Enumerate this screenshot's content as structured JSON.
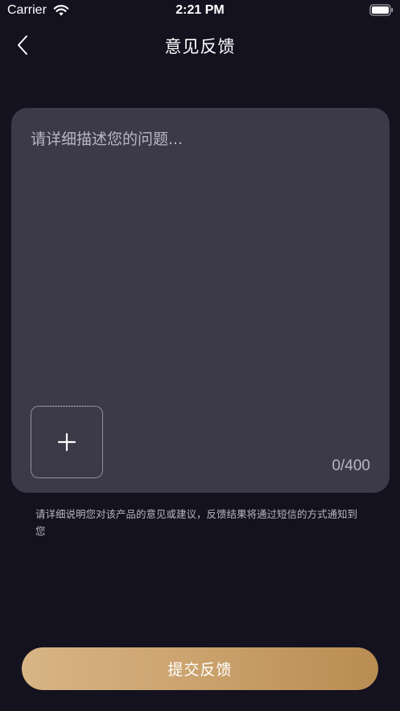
{
  "status_bar": {
    "carrier": "Carrier",
    "time": "2:21 PM"
  },
  "nav": {
    "title": "意见反馈",
    "back_icon": "chevron-left-icon"
  },
  "feedback": {
    "value": "",
    "placeholder": "请详细描述您的问题...",
    "add_image_icon": "plus-icon",
    "char_count": "0/400"
  },
  "hint": "请详细说明您对该产品的意见或建议，反馈结果将通过短信的方式通知到您",
  "submit_label": "提交反馈",
  "colors": {
    "background": "#14121f",
    "card": "#3c3a49",
    "accent_gradient_start": "#d8b585",
    "accent_gradient_end": "#b98c52"
  }
}
